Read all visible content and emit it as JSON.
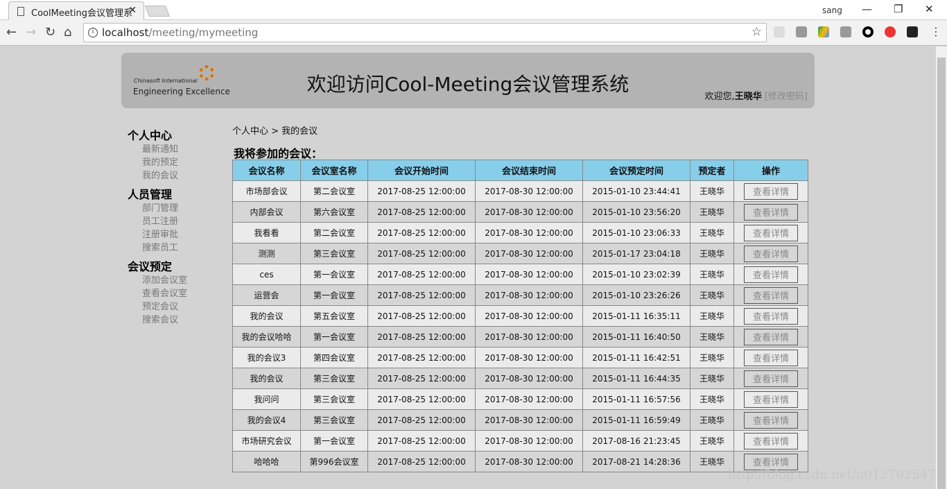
{
  "browser": {
    "tab_title": "CoolMeeting会议管理系",
    "user": "sang",
    "url_host": "localhost",
    "url_path": "/meeting/mymeeting"
  },
  "header": {
    "logo_line1": "Chinasoft International",
    "logo_line2": "Engineering Excellence",
    "title": "欢迎访问Cool-Meeting会议管理系统",
    "welcome": "欢迎您,",
    "username": "王晓华",
    "change_pwd": "[修改密码]"
  },
  "sidebar": [
    {
      "label": "个人中心",
      "items": [
        "最新通知",
        "我的预定",
        "我的会议"
      ]
    },
    {
      "label": "人员管理",
      "items": [
        "部门管理",
        "员工注册",
        "注册审批",
        "搜索员工"
      ]
    },
    {
      "label": "会议预定",
      "items": [
        "添加会议室",
        "查看会议室",
        "预定会议",
        "搜索会议"
      ]
    }
  ],
  "breadcrumb": "个人中心 > 我的会议",
  "section_title": "我将参加的会议：",
  "table": {
    "columns": [
      "会议名称",
      "会议室名称",
      "会议开始时间",
      "会议结束时间",
      "会议预定时间",
      "预定者",
      "操作"
    ],
    "action_label": "查看详情",
    "rows": [
      [
        "市场部会议",
        "第二会议室",
        "2017-08-25 12:00:00",
        "2017-08-30 12:00:00",
        "2015-01-10 23:44:41",
        "王晓华"
      ],
      [
        "内部会议",
        "第六会议室",
        "2017-08-25 12:00:00",
        "2017-08-30 12:00:00",
        "2015-01-10 23:56:20",
        "王晓华"
      ],
      [
        "我看看",
        "第二会议室",
        "2017-08-25 12:00:00",
        "2017-08-30 12:00:00",
        "2015-01-10 23:06:33",
        "王晓华"
      ],
      [
        "测测",
        "第三会议室",
        "2017-08-25 12:00:00",
        "2017-08-30 12:00:00",
        "2015-01-17 23:04:18",
        "王晓华"
      ],
      [
        "ces",
        "第一会议室",
        "2017-08-25 12:00:00",
        "2017-08-30 12:00:00",
        "2015-01-10 23:02:39",
        "王晓华"
      ],
      [
        "运营会",
        "第一会议室",
        "2017-08-25 12:00:00",
        "2017-08-30 12:00:00",
        "2015-01-10 23:26:26",
        "王晓华"
      ],
      [
        "我的会议",
        "第五会议室",
        "2017-08-25 12:00:00",
        "2017-08-30 12:00:00",
        "2015-01-11 16:35:11",
        "王晓华"
      ],
      [
        "我的会议哈哈",
        "第一会议室",
        "2017-08-25 12:00:00",
        "2017-08-30 12:00:00",
        "2015-01-11 16:40:50",
        "王晓华"
      ],
      [
        "我的会议3",
        "第四会议室",
        "2017-08-25 12:00:00",
        "2017-08-30 12:00:00",
        "2015-01-11 16:42:51",
        "王晓华"
      ],
      [
        "我的会议",
        "第三会议室",
        "2017-08-25 12:00:00",
        "2017-08-30 12:00:00",
        "2015-01-11 16:44:35",
        "王晓华"
      ],
      [
        "我问问",
        "第三会议室",
        "2017-08-25 12:00:00",
        "2017-08-30 12:00:00",
        "2015-01-11 16:57:56",
        "王晓华"
      ],
      [
        "我的会议4",
        "第三会议室",
        "2017-08-25 12:00:00",
        "2017-08-30 12:00:00",
        "2015-01-11 16:59:49",
        "王晓华"
      ],
      [
        "市场研究会议",
        "第一会议室",
        "2017-08-25 12:00:00",
        "2017-08-30 12:00:00",
        "2017-08-16 21:23:45",
        "王晓华"
      ],
      [
        "哈哈哈",
        "第996会议室",
        "2017-08-25 12:00:00",
        "2017-08-30 12:00:00",
        "2017-08-21 14:28:36",
        "王晓华"
      ]
    ]
  },
  "watermark": "http://blog.csdn.net/u012702547"
}
